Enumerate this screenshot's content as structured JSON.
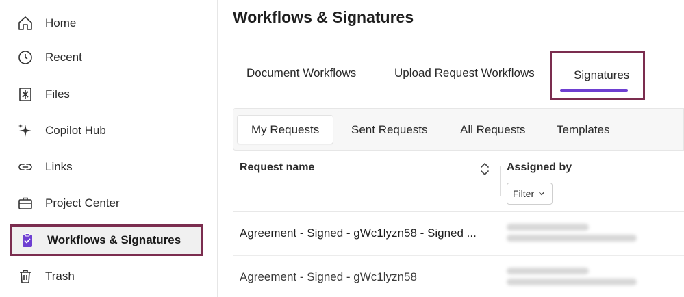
{
  "sidebar": {
    "items": [
      {
        "label": "Home",
        "icon": "home-icon"
      },
      {
        "label": "Recent",
        "icon": "clock-icon"
      },
      {
        "label": "Files",
        "icon": "files-icon"
      },
      {
        "label": "Copilot Hub",
        "icon": "sparkle-icon"
      },
      {
        "label": "Links",
        "icon": "link-icon"
      },
      {
        "label": "Project Center",
        "icon": "briefcase-icon"
      },
      {
        "label": "Workflows & Signatures",
        "icon": "clipboard-check-icon",
        "active": true
      },
      {
        "label": "Trash",
        "icon": "trash-icon"
      }
    ]
  },
  "main": {
    "title": "Workflows & Signatures",
    "tabs": [
      {
        "label": "Document Workflows"
      },
      {
        "label": "Upload Request Workflows"
      },
      {
        "label": "Signatures",
        "active": true
      }
    ],
    "subtabs": [
      {
        "label": "My Requests",
        "active": true
      },
      {
        "label": "Sent Requests"
      },
      {
        "label": "All Requests"
      },
      {
        "label": "Templates"
      }
    ],
    "table": {
      "columns": [
        {
          "label": "Request name"
        },
        {
          "label": "Assigned by"
        }
      ],
      "filter_label": "Filter",
      "rows": [
        {
          "name": "Agreement - Signed - gWc1lyzn58 - Signed ..."
        },
        {
          "name": "Agreement - Signed - gWc1lyzn58"
        }
      ]
    }
  },
  "colors": {
    "accent": "#6e3fd1",
    "highlight_border": "#7b2d4f",
    "active_icon": "#6e3fd1"
  }
}
